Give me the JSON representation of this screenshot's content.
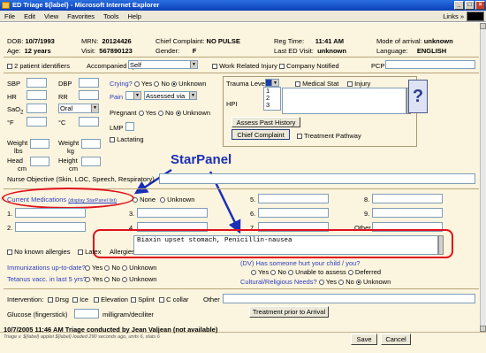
{
  "window": {
    "title": "ED Triage ${label} - Microsoft Internet Explorer",
    "buttons": [
      "_",
      "□",
      "×"
    ]
  },
  "menu": [
    "File",
    "Edit",
    "View",
    "Favorites",
    "Tools",
    "Help"
  ],
  "toolbar": {
    "links": "Links",
    "links_arrow": "»"
  },
  "patient": {
    "dob_label": "DOB:",
    "dob": "10/7/1993",
    "age_label": "Age:",
    "age": "12 years",
    "mrn_label": "MRN:",
    "mrn": "20124426",
    "visit_label": "Visit:",
    "visit": "567890123",
    "cc_label": "Chief Complaint:",
    "cc": "NO PULSE",
    "gender_label": "Gender:",
    "gender": "F",
    "reg_label": "Reg Time:",
    "reg_time": "11:41 AM",
    "last_label": "Last ED Visit:",
    "last_visit": "unknown",
    "arrival_label": "Mode of arrival:",
    "arrival": "unknown",
    "lang_label": "Language:",
    "language": "ENGLISH"
  },
  "row1": {
    "two_ids": "2 patient identifiers",
    "accompanied": "Accompanied by",
    "accompanied_val": "Self",
    "work": "Work Related Injury",
    "company": "Company Notified",
    "pcp": "PCP"
  },
  "vitals": {
    "sbp": "SBP",
    "dbp": "DBP",
    "hr": "HR",
    "rr": "RR",
    "sao2": "SaO",
    "sao2_sub": "2",
    "oral": "Oral",
    "degf": "°F",
    "degc": "°C",
    "wt_lbs_1": "Weight",
    "wt_lbs_2": "lbs",
    "wt_kg_1": "Weight",
    "wt_kg_2": "kg",
    "head_1": "Head",
    "head_2": "cm",
    "height_1": "Height",
    "height_2": "cm"
  },
  "assess": {
    "crying": "Crying?",
    "yes": "Yes",
    "no": "No",
    "unknown": "Unknown",
    "pain": "Pain",
    "assessed": "Assessed via",
    "pregnant": "Pregnant",
    "lmp": "LMP",
    "lactating": "Lactating"
  },
  "trauma": {
    "level": "Trauma Level",
    "options": [
      "1",
      "2",
      "3"
    ],
    "medical": "Medical Stat",
    "injury": "Injury",
    "hpi": "HPI",
    "assess_btn": "Assess Past History",
    "cc_btn": "Chief Complaint",
    "treatment": "Treatment Pathway",
    "help": "?"
  },
  "nurse": {
    "label": "Nurse Objective (Skin, LOC, Speech, Respiratory)"
  },
  "meds": {
    "label": "Current Medications",
    "display": "(display StarPanel list)",
    "none": "None",
    "unknown": "Unknown",
    "nums": [
      "1.",
      "2.",
      "3.",
      "4.",
      "5.",
      "6.",
      "7.",
      "8.",
      "9."
    ],
    "other": "Other"
  },
  "annotation": {
    "starpanel": "StarPanel"
  },
  "allergy": {
    "no_known": "No known allergies",
    "latex": "Latex",
    "label": "Allergies",
    "text": "Biaxin upset stomach, Penicillin-nausea"
  },
  "immun": {
    "label": "Immunizations up-to-date?",
    "tetanus": "Tetanus vacc. in last 5 yrs?",
    "yes": "Yes",
    "no": "No",
    "unknown": "Unknown"
  },
  "dv": {
    "label": "(DV) Has someone hurt your child / you?",
    "yes": "Yes",
    "no": "No",
    "unable": "Unable to assess",
    "deferred": "Deferred",
    "cultural": "Cultural/Religious Needs?",
    "unknown": "Unknown"
  },
  "interv": {
    "label": "Intervention:",
    "drsg": "Drsg",
    "ice": "Ice",
    "elevation": "Elevation",
    "splint": "Splint",
    "ccollar": "C collar",
    "other": "Other",
    "glucose": "Glucose (fingerstick)",
    "mgdl": "milligram/deciliter",
    "treatment_btn": "Treatment prior to Arrival"
  },
  "status": {
    "line1": "10/7/2005 11:46 AM  Triage conducted by Jean Valjean (not available)",
    "line2": "Triage v. ${label} applet ${label} loaded 290 seconds ago, units 6, stats 6",
    "save": "Save",
    "cancel": "Cancel"
  }
}
